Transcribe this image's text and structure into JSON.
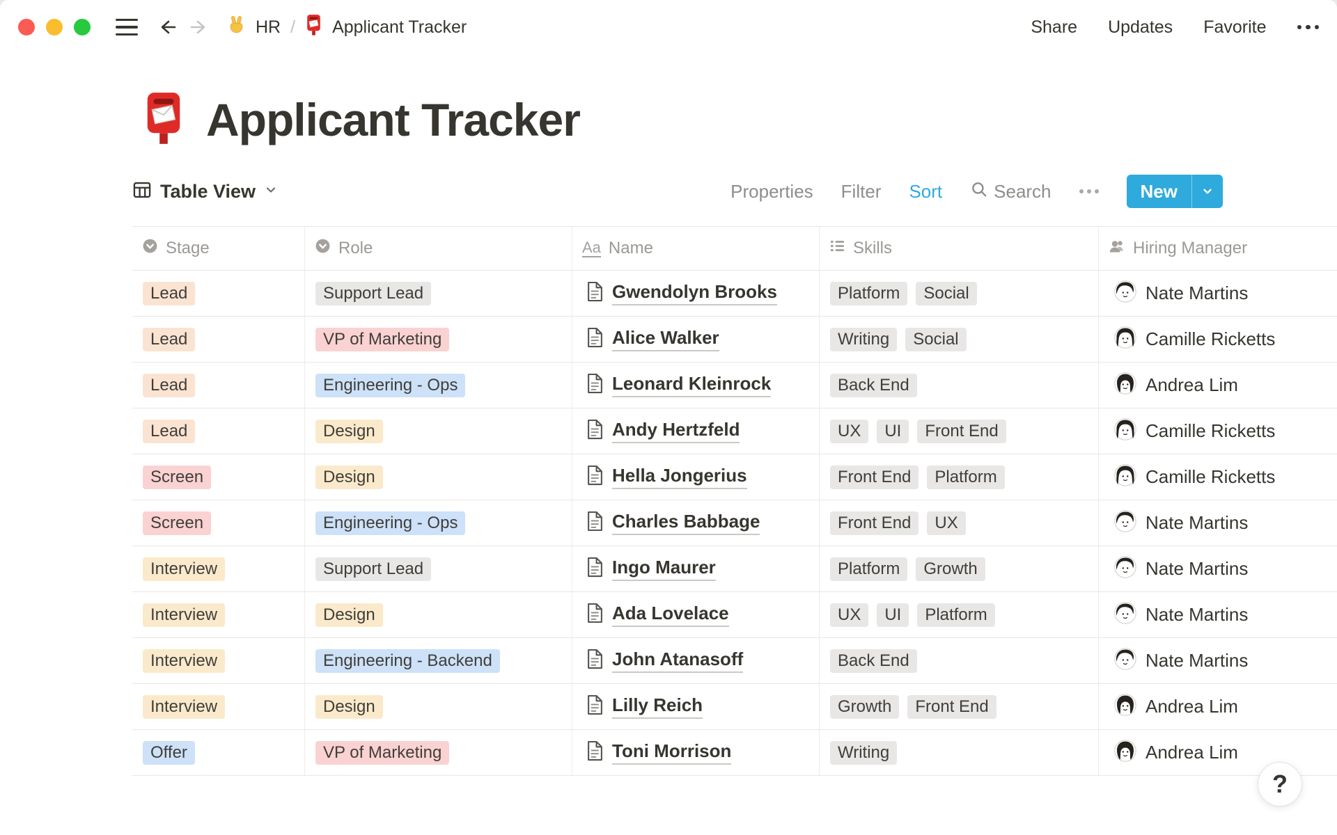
{
  "topbar": {
    "window_controls": [
      "close",
      "minimize",
      "maximize"
    ],
    "breadcrumb": {
      "workspace_emoji": "victory-hand",
      "workspace": "HR",
      "separator": "/",
      "page_emoji": "postbox",
      "page": "Applicant Tracker"
    },
    "actions": {
      "share": "Share",
      "updates": "Updates",
      "favorite": "Favorite",
      "more": "more-options"
    }
  },
  "page": {
    "emoji": "postbox",
    "title": "Applicant Tracker"
  },
  "toolbar": {
    "view_label": "Table View",
    "properties_label": "Properties",
    "filter_label": "Filter",
    "sort_label": "Sort",
    "search_label": "Search",
    "more_label": "more-options",
    "new_label": "New"
  },
  "icons": {
    "text_icon": "Aa"
  },
  "colors": {
    "accent_blue": "#2EAADC",
    "traffic_red": "#FB5A55",
    "traffic_yellow": "#F9BD2E",
    "traffic_green": "#27C93F",
    "tags": {
      "orange": "#FBE3D2",
      "red": "#FAD2D2",
      "yellow": "#FAEACB",
      "blue": "#CDE1F8",
      "gray": "#E8E7E5"
    }
  },
  "table": {
    "columns": [
      {
        "label": "Stage",
        "icon": "select-icon"
      },
      {
        "label": "Role",
        "icon": "select-icon"
      },
      {
        "label": "Name",
        "icon": "text-icon"
      },
      {
        "label": "Skills",
        "icon": "multi-select-icon"
      },
      {
        "label": "Hiring Manager",
        "icon": "person-icon"
      }
    ],
    "rows": [
      {
        "stage": {
          "label": "Lead",
          "color": "orange"
        },
        "role": {
          "label": "Support Lead",
          "color": "gray"
        },
        "name": "Gwendolyn Brooks",
        "skills": [
          "Platform",
          "Social"
        ],
        "manager": {
          "name": "Nate Martins",
          "avatar": "nate"
        }
      },
      {
        "stage": {
          "label": "Lead",
          "color": "orange"
        },
        "role": {
          "label": "VP of Marketing",
          "color": "red"
        },
        "name": "Alice Walker",
        "skills": [
          "Writing",
          "Social"
        ],
        "manager": {
          "name": "Camille Ricketts",
          "avatar": "camille"
        }
      },
      {
        "stage": {
          "label": "Lead",
          "color": "orange"
        },
        "role": {
          "label": "Engineering - Ops",
          "color": "blue"
        },
        "name": "Leonard Kleinrock",
        "skills": [
          "Back End"
        ],
        "manager": {
          "name": "Andrea Lim",
          "avatar": "andrea"
        }
      },
      {
        "stage": {
          "label": "Lead",
          "color": "orange"
        },
        "role": {
          "label": "Design",
          "color": "yellow"
        },
        "name": "Andy Hertzfeld",
        "skills": [
          "UX",
          "UI",
          "Front End"
        ],
        "manager": {
          "name": "Camille Ricketts",
          "avatar": "camille"
        }
      },
      {
        "stage": {
          "label": "Screen",
          "color": "red"
        },
        "role": {
          "label": "Design",
          "color": "yellow"
        },
        "name": "Hella Jongerius",
        "skills": [
          "Front End",
          "Platform"
        ],
        "manager": {
          "name": "Camille Ricketts",
          "avatar": "camille"
        }
      },
      {
        "stage": {
          "label": "Screen",
          "color": "red"
        },
        "role": {
          "label": "Engineering - Ops",
          "color": "blue"
        },
        "name": "Charles Babbage",
        "skills": [
          "Front End",
          "UX"
        ],
        "manager": {
          "name": "Nate Martins",
          "avatar": "nate"
        }
      },
      {
        "stage": {
          "label": "Interview",
          "color": "yellow"
        },
        "role": {
          "label": "Support Lead",
          "color": "gray"
        },
        "name": "Ingo Maurer",
        "skills": [
          "Platform",
          "Growth"
        ],
        "manager": {
          "name": "Nate Martins",
          "avatar": "nate"
        }
      },
      {
        "stage": {
          "label": "Interview",
          "color": "yellow"
        },
        "role": {
          "label": "Design",
          "color": "yellow"
        },
        "name": "Ada Lovelace",
        "skills": [
          "UX",
          "UI",
          "Platform"
        ],
        "manager": {
          "name": "Nate Martins",
          "avatar": "nate"
        }
      },
      {
        "stage": {
          "label": "Interview",
          "color": "yellow"
        },
        "role": {
          "label": "Engineering - Backend",
          "color": "blue"
        },
        "name": "John Atanasoff",
        "skills": [
          "Back End"
        ],
        "manager": {
          "name": "Nate Martins",
          "avatar": "nate"
        }
      },
      {
        "stage": {
          "label": "Interview",
          "color": "yellow"
        },
        "role": {
          "label": "Design",
          "color": "yellow"
        },
        "name": "Lilly Reich",
        "skills": [
          "Growth",
          "Front End"
        ],
        "manager": {
          "name": "Andrea Lim",
          "avatar": "andrea"
        }
      },
      {
        "stage": {
          "label": "Offer",
          "color": "blue"
        },
        "role": {
          "label": "VP of Marketing",
          "color": "red"
        },
        "name": "Toni Morrison",
        "skills": [
          "Writing"
        ],
        "manager": {
          "name": "Andrea Lim",
          "avatar": "andrea"
        }
      }
    ]
  },
  "help_button": {
    "label": "?"
  }
}
